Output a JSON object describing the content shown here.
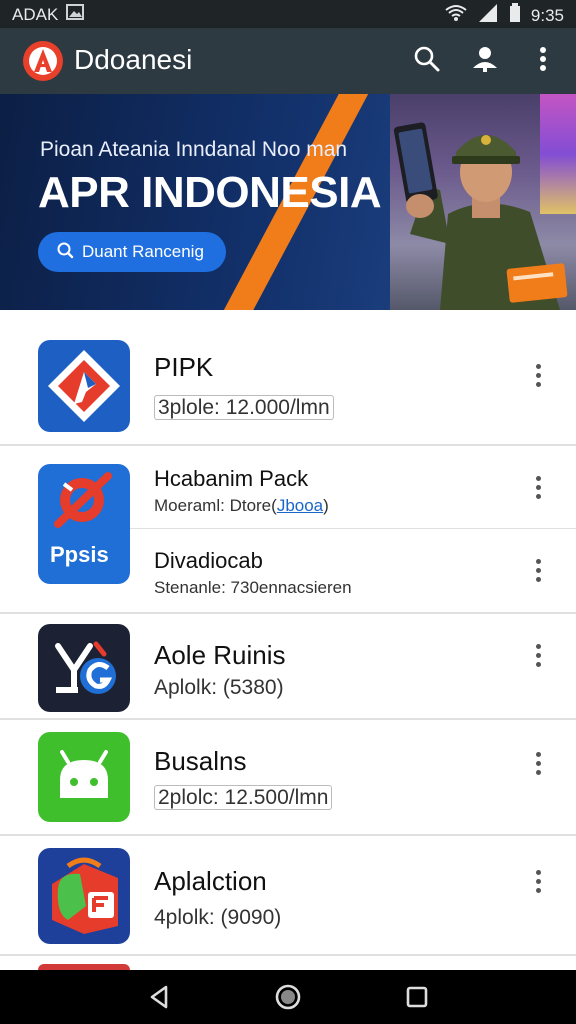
{
  "status_bar": {
    "left_text": "ADAK",
    "time": "9:35"
  },
  "app_bar": {
    "title": "Ddoanesi",
    "icons": [
      "search-icon",
      "profile-icon",
      "more-vert-icon"
    ]
  },
  "banner": {
    "subtitle": "Pioan Ateania Inndanal Noo man",
    "headline": "APR INDONESIA",
    "cta_label": "Duant Rancenig"
  },
  "apps": [
    {
      "name": "PIPK",
      "meta": "3plole: 12.000/lmn"
    },
    {
      "name": "Hcabanim Pack",
      "meta_prefix": "Moeraml: Dtore(",
      "meta_link": "Jbooa",
      "meta_suffix": ")"
    },
    {
      "name": "Divadiocab",
      "meta": "Stenanle: 730ennacsieren",
      "icon_text": "Ppsis"
    },
    {
      "name": "Aole Ruinis",
      "meta": "Aplolk: (5380)"
    },
    {
      "name": "Busalns",
      "meta": "2plolc: 12.500/lmn"
    },
    {
      "name": "Aplalction",
      "meta": "4plolk: (9090)"
    }
  ],
  "colors": {
    "app_bar": "#2e3a41",
    "accent_orange": "#f07d1a",
    "cta_blue": "#1f6fe0"
  }
}
